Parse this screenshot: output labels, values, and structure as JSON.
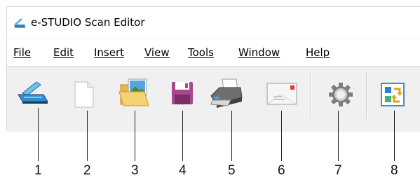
{
  "window": {
    "title": "e-STUDIO Scan Editor",
    "icon": "scanner-app-icon"
  },
  "menu": [
    "File",
    "Edit",
    "Insert",
    "View",
    "Tools",
    "Window",
    "Help"
  ],
  "toolbar": [
    {
      "icon": "scanner-icon"
    },
    {
      "icon": "new-document-icon"
    },
    {
      "icon": "open-folder-icon"
    },
    {
      "icon": "save-floppy-icon"
    },
    {
      "icon": "printer-icon"
    },
    {
      "icon": "email-envelope-icon"
    },
    {
      "icon": "gear-settings-icon"
    },
    {
      "icon": "swap-arrows-icon"
    }
  ],
  "callouts": [
    "1",
    "2",
    "3",
    "4",
    "5",
    "6",
    "7",
    "8"
  ],
  "colors": {
    "menubar_bg": "#ffffff",
    "toolbar_bg": "#f0f0f0",
    "save_icon": "#a8488f",
    "settings_icon": "#7d7d7d"
  }
}
